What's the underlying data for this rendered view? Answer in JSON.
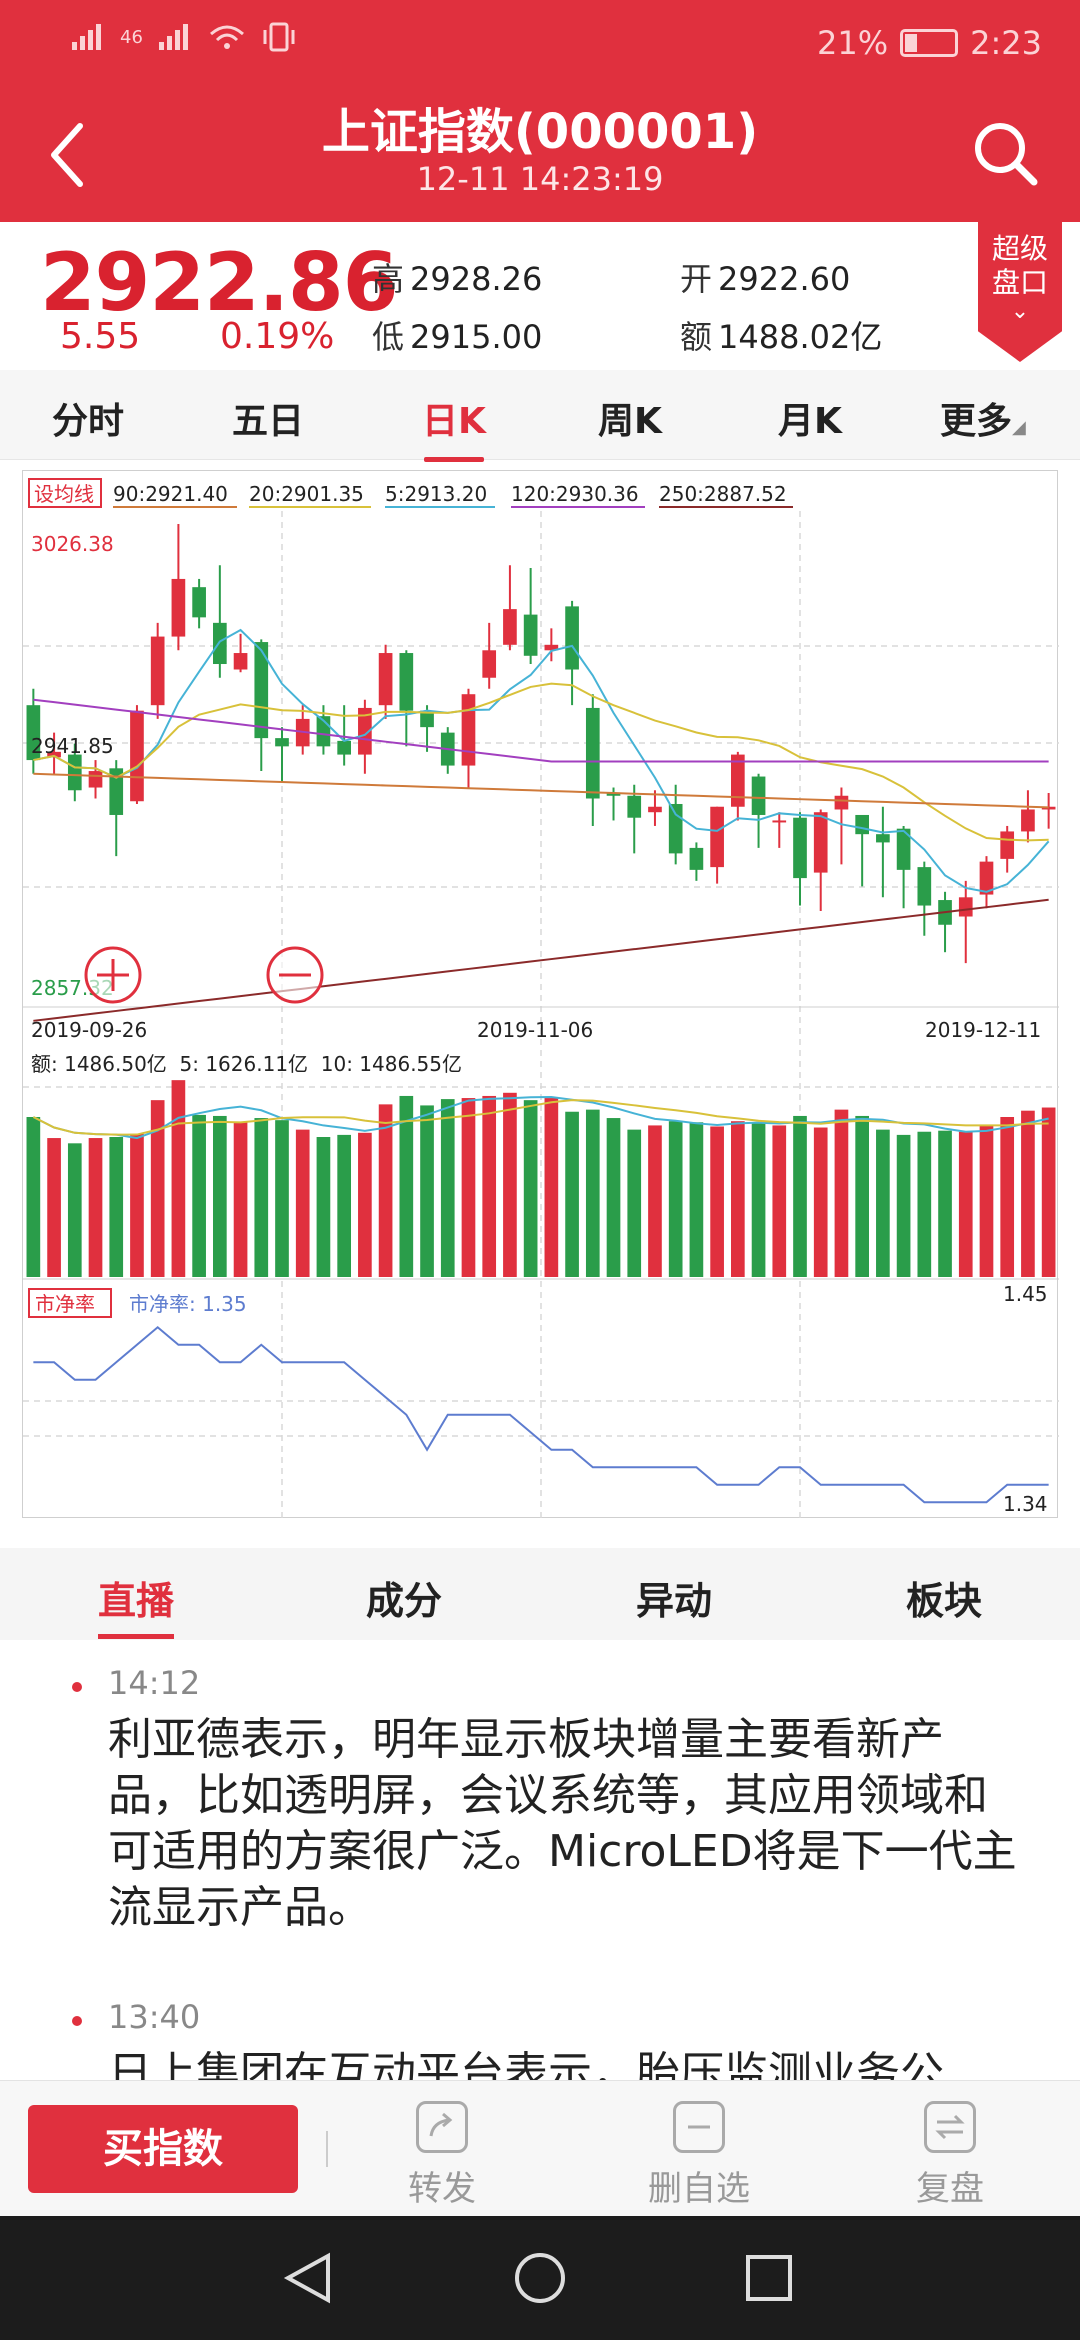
{
  "status_bar": {
    "signal": "46",
    "battery": "21%",
    "time": "2:23"
  },
  "header": {
    "title": "上证指数(000001)",
    "subtitle": "12-11 14:23:19"
  },
  "quote": {
    "price": "2922.86",
    "change": "5.55",
    "change_pct": "0.19%",
    "high_label": "高",
    "high": "2928.26",
    "low_label": "低",
    "low": "2915.00",
    "open_label": "开",
    "open": "2922.60",
    "amount_label": "额",
    "amount": "1488.02亿"
  },
  "super_panel": {
    "label_1": "超级",
    "label_2": "盘口"
  },
  "period_tabs": [
    {
      "label": "分时"
    },
    {
      "label": "五日"
    },
    {
      "label": "日K"
    },
    {
      "label": "周K"
    },
    {
      "label": "月K"
    },
    {
      "label": "更多"
    }
  ],
  "ma_legend": {
    "set_label": "设均线",
    "ma90": "90:2921.40",
    "ma20": "20:2901.35",
    "ma5": "5:2913.20",
    "ma120": "120:2930.36",
    "ma250": "250:2887.52"
  },
  "axis": {
    "price_high": "3026.38",
    "price_mid": "2941.85",
    "price_low": "2857.32",
    "date_start": "2019-09-26",
    "date_mid": "2019-11-06",
    "date_end": "2019-12-11"
  },
  "volume_legend": {
    "text": "额: 1486.50亿  5: 1626.11亿  10: 1486.55亿"
  },
  "pb_legend": {
    "tag": "市净率",
    "value": "市净率: 1.35",
    "max": "1.45",
    "min": "1.34"
  },
  "colors": {
    "up": "#e0303e",
    "down": "#2a9d4a",
    "ma5": "#46b3d6",
    "ma20": "#d8c13a",
    "ma90": "#cf7a3a",
    "ma120": "#a23fbf",
    "ma250": "#8b2a2a",
    "pb": "#5d7ccf"
  },
  "chart_data": {
    "type": "candlestick",
    "y_range": [
      2857.32,
      3026.38
    ],
    "candles": [
      [
        2960,
        2940,
        2966,
        2935
      ],
      [
        2941,
        2943,
        2950,
        2935
      ],
      [
        2942,
        2929,
        2946,
        2925
      ],
      [
        2930,
        2936,
        2940,
        2926
      ],
      [
        2937,
        2920,
        2940,
        2905
      ],
      [
        2925,
        2958,
        2960,
        2924
      ],
      [
        2960,
        2985,
        2990,
        2955
      ],
      [
        2985,
        3006,
        3026,
        2980
      ],
      [
        3003,
        2992,
        3006,
        2988
      ],
      [
        2990,
        2975,
        3011,
        2970
      ],
      [
        2973,
        2979,
        2986,
        2972
      ],
      [
        2983,
        2948,
        2984,
        2936
      ],
      [
        2948,
        2945,
        2952,
        2932
      ],
      [
        2945,
        2955,
        2960,
        2942
      ],
      [
        2956,
        2945,
        2960,
        2942
      ],
      [
        2947,
        2942,
        2960,
        2938
      ],
      [
        2942,
        2959,
        2962,
        2935
      ],
      [
        2960,
        2979,
        2982,
        2955
      ],
      [
        2979,
        2958,
        2980,
        2945
      ],
      [
        2958,
        2952,
        2960,
        2943
      ],
      [
        2950,
        2938,
        2952,
        2935
      ],
      [
        2938,
        2964,
        2966,
        2930
      ],
      [
        2970,
        2980,
        2990,
        2966
      ],
      [
        2982,
        2995,
        3011,
        2980
      ],
      [
        2993,
        2978,
        3010,
        2975
      ],
      [
        2980,
        2982,
        2988,
        2976
      ],
      [
        2996,
        2973,
        2998,
        2960
      ],
      [
        2959,
        2926,
        2964,
        2916
      ],
      [
        2928,
        2927,
        2930,
        2918
      ],
      [
        2927,
        2919,
        2931,
        2906
      ],
      [
        2921,
        2923,
        2929,
        2916
      ],
      [
        2924,
        2906,
        2931,
        2902
      ],
      [
        2908,
        2900,
        2910,
        2896
      ],
      [
        2901,
        2923,
        2923,
        2895
      ],
      [
        2923,
        2942,
        2943,
        2918
      ],
      [
        2934,
        2920,
        2935,
        2908
      ],
      [
        2918,
        2918,
        2921,
        2908
      ],
      [
        2919,
        2897,
        2921,
        2887
      ],
      [
        2899,
        2921,
        2922,
        2885
      ],
      [
        2922,
        2927,
        2930,
        2902
      ],
      [
        2920,
        2913,
        2920,
        2894
      ],
      [
        2913,
        2910,
        2923,
        2890
      ],
      [
        2915,
        2900,
        2916,
        2886
      ],
      [
        2901,
        2887,
        2903,
        2876
      ],
      [
        2889,
        2880,
        2892,
        2870
      ],
      [
        2883,
        2890,
        2896,
        2866
      ],
      [
        2891,
        2903,
        2905,
        2886
      ],
      [
        2904,
        2914,
        2916,
        2899
      ],
      [
        2914,
        2922,
        2929,
        2910
      ],
      [
        2922,
        2923,
        2928,
        2915
      ]
    ],
    "volume": [
      1520,
      1320,
      1270,
      1320,
      1330,
      1360,
      1680,
      1870,
      1540,
      1530,
      1470,
      1510,
      1490,
      1400,
      1330,
      1350,
      1370,
      1640,
      1720,
      1630,
      1690,
      1700,
      1720,
      1750,
      1680,
      1700,
      1570,
      1590,
      1510,
      1400,
      1440,
      1480,
      1470,
      1430,
      1480,
      1470,
      1440,
      1530,
      1420,
      1590,
      1530,
      1400,
      1350,
      1380,
      1390,
      1380,
      1440,
      1520,
      1580,
      1610
    ],
    "pb": [
      1.42,
      1.42,
      1.41,
      1.41,
      1.42,
      1.43,
      1.44,
      1.43,
      1.43,
      1.42,
      1.42,
      1.43,
      1.42,
      1.42,
      1.42,
      1.42,
      1.41,
      1.4,
      1.39,
      1.37,
      1.39,
      1.39,
      1.39,
      1.39,
      1.38,
      1.37,
      1.37,
      1.36,
      1.36,
      1.36,
      1.36,
      1.36,
      1.36,
      1.35,
      1.35,
      1.35,
      1.36,
      1.36,
      1.35,
      1.35,
      1.35,
      1.35,
      1.35,
      1.34,
      1.34,
      1.34,
      1.34,
      1.35,
      1.35,
      1.35
    ],
    "pb_range": [
      1.335,
      1.455
    ]
  },
  "feed_tabs": [
    {
      "label": "直播"
    },
    {
      "label": "成分"
    },
    {
      "label": "异动"
    },
    {
      "label": "板块"
    }
  ],
  "news": [
    {
      "time": "14:12",
      "text": "利亚德表示，明年显示板块增量主要看新产品，比如透明屏，会议系统等，其应用领域和可适用的方案很广泛。MicroLED将是下一代主流显示产品。"
    },
    {
      "time": "13:40",
      "text": "日上集团在互动平台表示，胎压监测业务公"
    }
  ],
  "bottom_bar": {
    "buy": "买指数",
    "share": "转发",
    "remove": "删自选",
    "review": "复盘"
  }
}
